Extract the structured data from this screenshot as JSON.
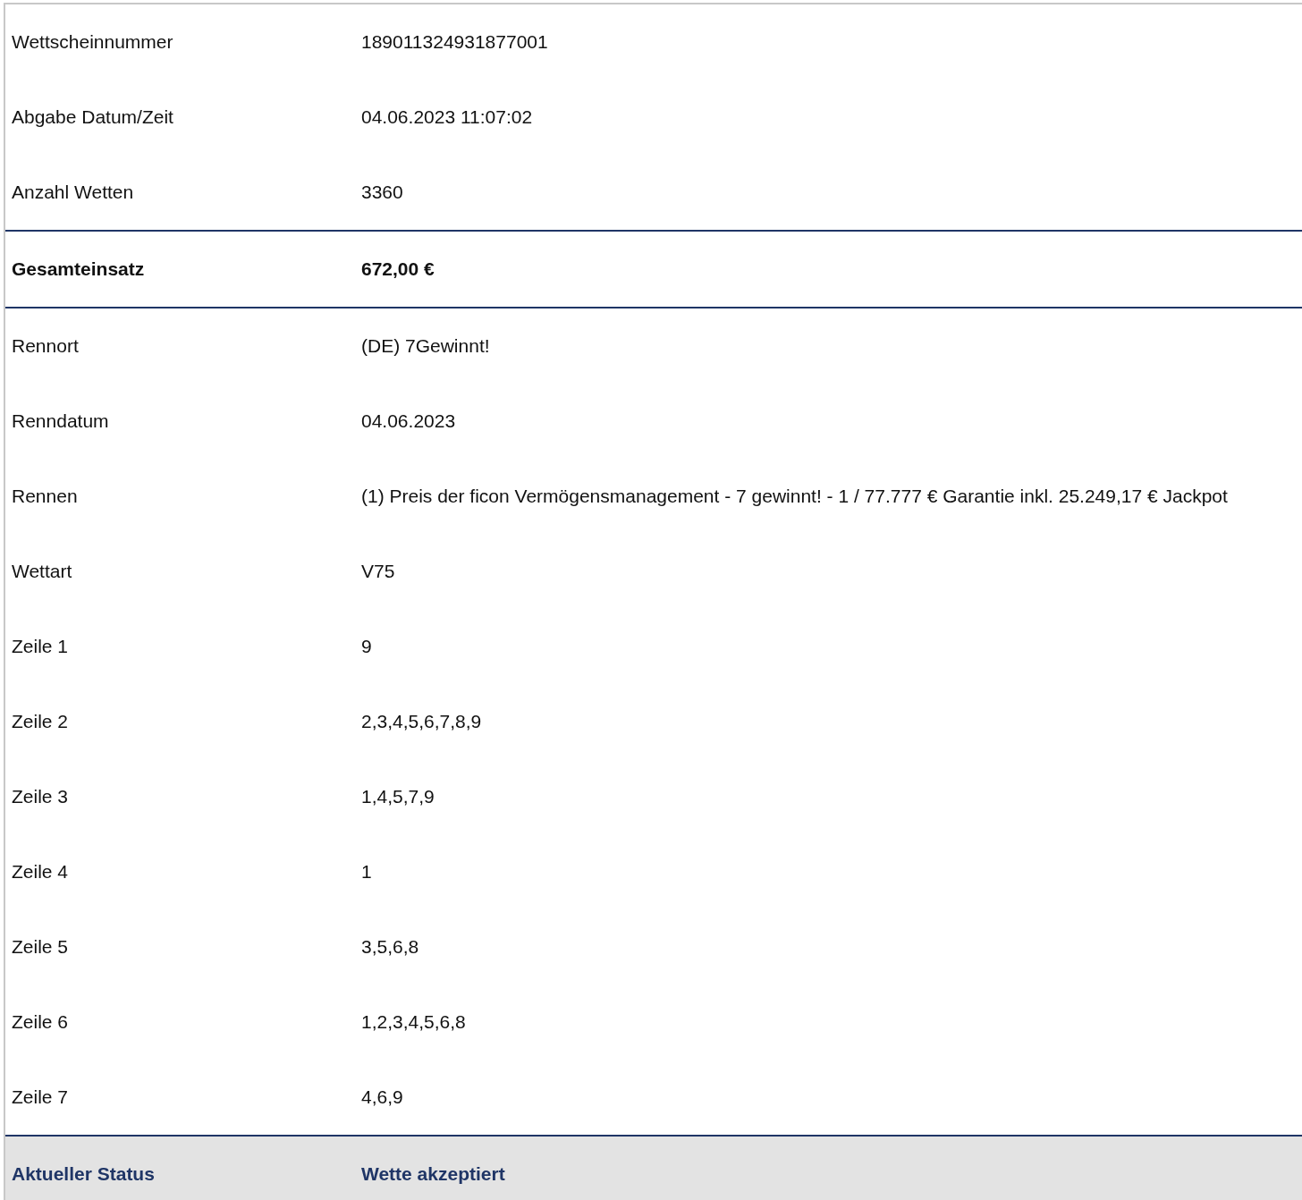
{
  "sections": [
    {
      "kind": "plain",
      "rows": [
        {
          "label": "Wettscheinnummer",
          "value": "189011324931877001"
        },
        {
          "label": "Abgabe Datum/Zeit",
          "value": "04.06.2023 11:07:02"
        },
        {
          "label": "Anzahl Wetten",
          "value": "3360"
        }
      ]
    },
    {
      "kind": "total",
      "rows": [
        {
          "label": "Gesamteinsatz",
          "value": "672,00 €"
        }
      ]
    },
    {
      "kind": "plain",
      "rows": [
        {
          "label": "Rennort",
          "value": "(DE) 7Gewinnt!"
        },
        {
          "label": "Renndatum",
          "value": "04.06.2023"
        },
        {
          "label": "Rennen",
          "value": "(1) Preis der ficon Vermögensmanagement - 7 gewinnt! - 1 / 77.777 € Garantie inkl. 25.249,17 € Jackpot"
        },
        {
          "label": "Wettart",
          "value": "V75"
        },
        {
          "label": "Zeile 1",
          "value": "9"
        },
        {
          "label": "Zeile 2",
          "value": "2,3,4,5,6,7,8,9"
        },
        {
          "label": "Zeile 3",
          "value": "1,4,5,7,9"
        },
        {
          "label": "Zeile 4",
          "value": "1"
        },
        {
          "label": "Zeile 5",
          "value": "3,5,6,8"
        },
        {
          "label": "Zeile 6",
          "value": "1,2,3,4,5,6,8"
        },
        {
          "label": "Zeile 7",
          "value": "4,6,9"
        }
      ]
    },
    {
      "kind": "status",
      "rows": [
        {
          "label": "Aktueller Status",
          "value": "Wette akzeptiert"
        }
      ]
    }
  ]
}
